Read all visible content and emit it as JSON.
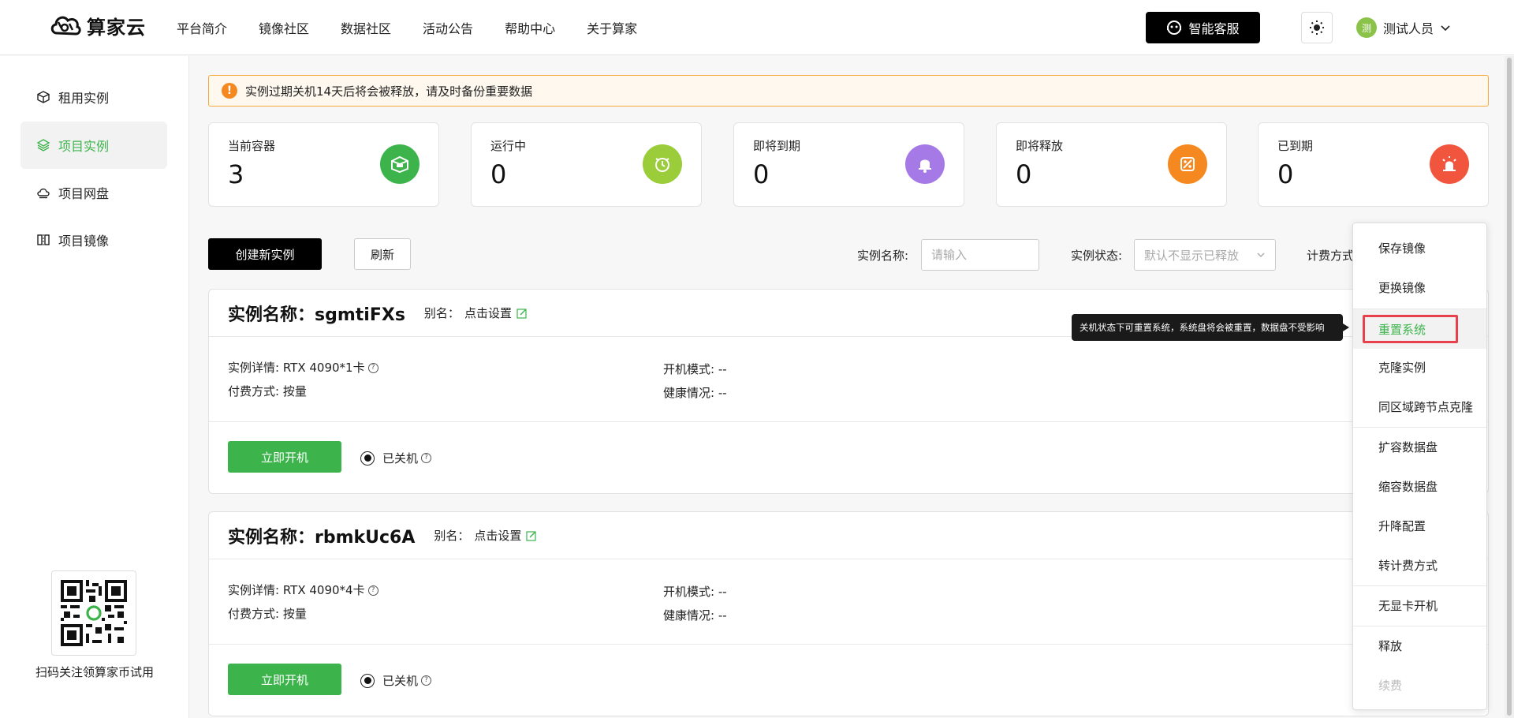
{
  "header": {
    "logo_text": "算家云",
    "nav": [
      "平台简介",
      "镜像社区",
      "数据社区",
      "活动公告",
      "帮助中心",
      "关于算家"
    ],
    "service_button": "智能客服",
    "user_avatar": "测",
    "user_name": "测试人员"
  },
  "sidebar": {
    "items": [
      {
        "label": "租用实例",
        "icon": "cube-icon"
      },
      {
        "label": "项目实例",
        "icon": "layers-icon"
      },
      {
        "label": "项目网盘",
        "icon": "cloud-drive-icon"
      },
      {
        "label": "项目镜像",
        "icon": "mirror-icon"
      }
    ],
    "qr_caption": "扫码关注领算家币试用"
  },
  "notice": "实例过期关机14天后将会被释放，请及时备份重要数据",
  "stats": [
    {
      "label": "当前容器",
      "value": "3",
      "color": "#3cb44b"
    },
    {
      "label": "运行中",
      "value": "0",
      "color": "#9bcc3a"
    },
    {
      "label": "即将到期",
      "value": "0",
      "color": "#a67ae6"
    },
    {
      "label": "即将释放",
      "value": "0",
      "color": "#f5891f"
    },
    {
      "label": "已到期",
      "value": "0",
      "color": "#f2553d"
    }
  ],
  "toolbar": {
    "create_label": "创建新实例",
    "refresh_label": "刷新",
    "name_label": "实例名称:",
    "name_placeholder": "请输入",
    "status_label": "实例状态:",
    "status_placeholder": "默认不显示已释放",
    "billing_label": "计费方式"
  },
  "instances": [
    {
      "title": "实例名称：sgmtiFXs",
      "alias_label": "别名：",
      "alias_value": "点击设置",
      "detail_label": "实例详情:",
      "detail_value": "RTX 4090*1卡",
      "pay_label": "付费方式:",
      "pay_value": "按量",
      "boot_label": "开机模式:",
      "boot_value": "--",
      "health_label": "健康情况:",
      "health_value": "--",
      "start_label": "立即开机",
      "status": "已关机"
    },
    {
      "title": "实例名称：rbmkUc6A",
      "alias_label": "别名：",
      "alias_value": "点击设置",
      "detail_label": "实例详情:",
      "detail_value": "RTX 4090*4卡",
      "pay_label": "付费方式:",
      "pay_value": "按量",
      "boot_label": "开机模式:",
      "boot_value": "--",
      "health_label": "健康情况:",
      "health_value": "--",
      "start_label": "立即开机",
      "status": "已关机"
    }
  ],
  "dropdown": {
    "items": [
      "保存镜像",
      "更换镜像",
      "重置系统",
      "克隆实例",
      "同区域跨节点克隆",
      "扩容数据盘",
      "缩容数据盘",
      "升降配置",
      "转计费方式",
      "无显卡开机",
      "释放",
      "续费"
    ]
  },
  "tooltip": "关机状态下可重置系统，系统盘将会被重置，数据盘不受影响"
}
